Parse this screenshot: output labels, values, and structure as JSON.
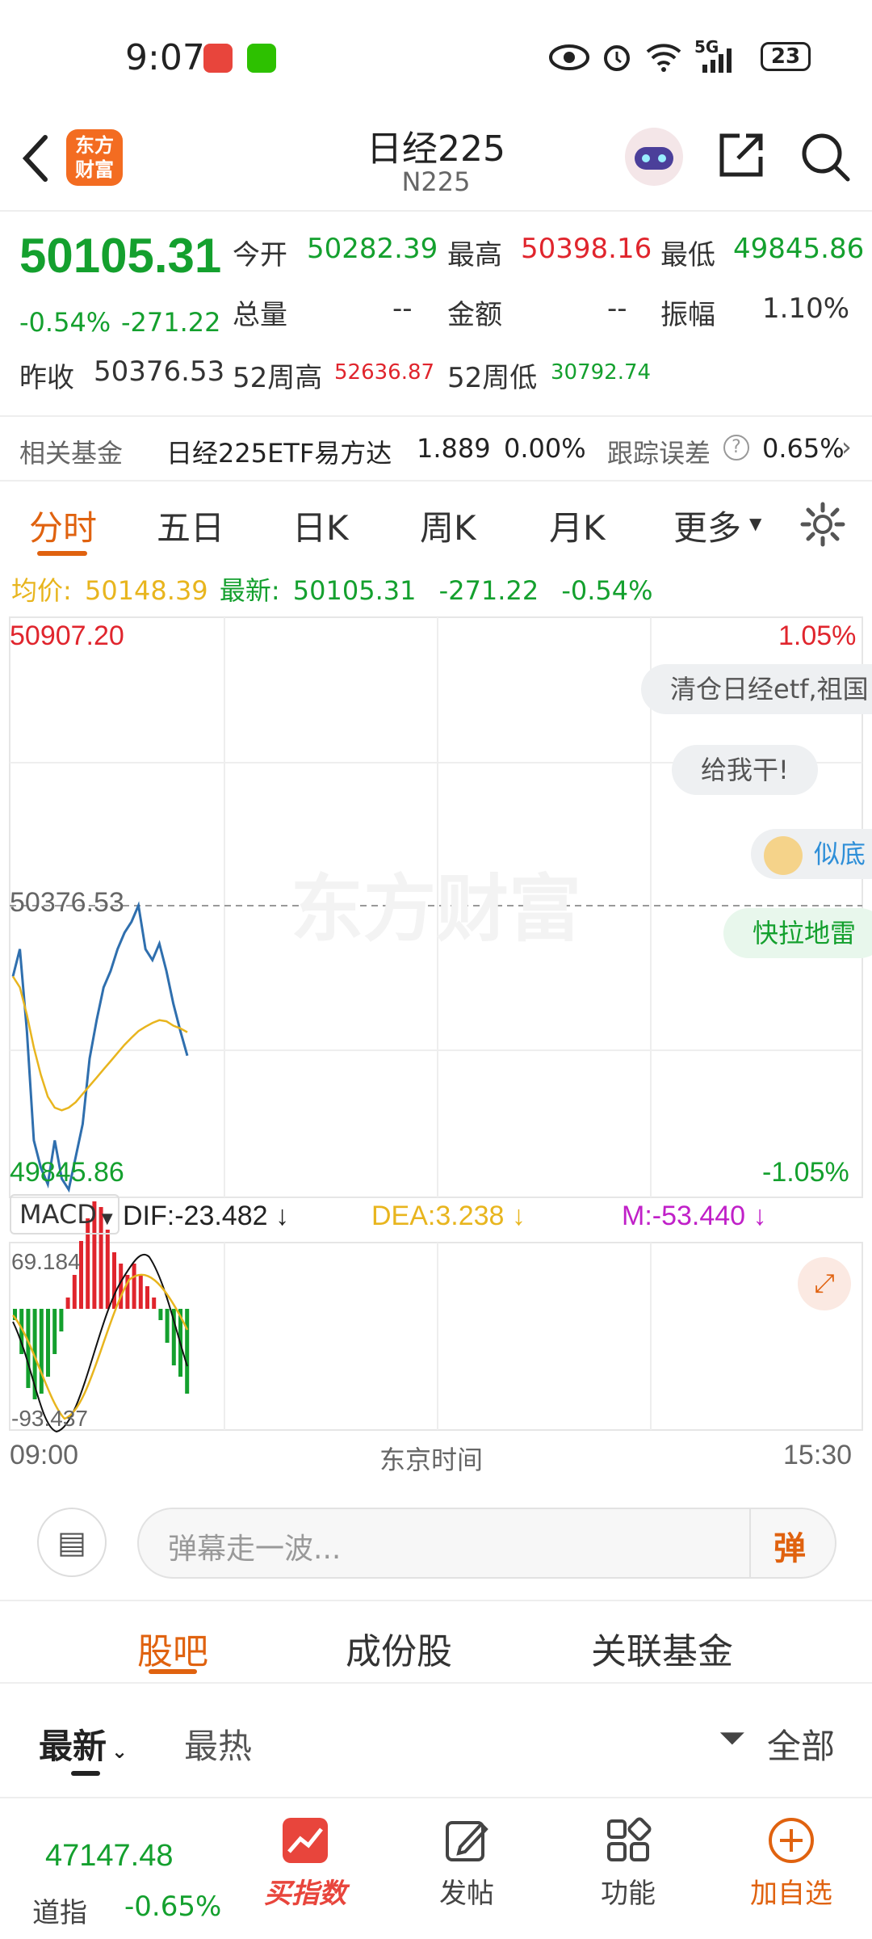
{
  "status_bar": {
    "time": "9:07",
    "network": "5G",
    "battery": "23"
  },
  "header": {
    "logo_text": "东方财富",
    "title": "日经225",
    "subtitle": "N225"
  },
  "quote": {
    "price": "50105.31",
    "change_pct": "-0.54%",
    "change": "-271.22",
    "open_label": "今开",
    "open": "50282.39",
    "high_label": "最高",
    "high": "50398.16",
    "low_label": "最低",
    "low": "49845.86",
    "volume_label": "总量",
    "volume": "--",
    "amount_label": "金额",
    "amount": "--",
    "amplitude_label": "振幅",
    "amplitude": "1.10%",
    "prev_close_label": "昨收",
    "prev_close": "50376.53",
    "w52_high_label": "52周高",
    "w52_high": "52636.87",
    "w52_low_label": "52周低",
    "w52_low": "30792.74"
  },
  "fund_row": {
    "label": "相关基金",
    "name": "日经225ETF易方达",
    "price": "1.889",
    "change": "0.00%",
    "tracking_label": "跟踪误差",
    "tracking_value": "0.65%"
  },
  "tabs": [
    "分时",
    "五日",
    "日K",
    "周K",
    "月K",
    "更多"
  ],
  "avg_line": {
    "avg_label": "均价:",
    "avg_value": "50148.39",
    "latest_label": "最新:",
    "latest_value": "50105.31",
    "change": "-271.22",
    "change_pct": "-0.54%"
  },
  "chart": {
    "top_price": "50907.20",
    "top_pct": "1.05%",
    "mid_price": "50376.53",
    "bottom_price": "49845.86",
    "bottom_pct": "-1.05%",
    "watermark": "东方财富",
    "macd_select": "MACD",
    "dif": "DIF:-23.482",
    "dea": "DEA:3.238",
    "m": "M:-53.440",
    "macd_top": "69.184",
    "macd_bottom": "-93.437",
    "time_start": "09:00",
    "time_label": "东京时间",
    "time_end": "15:30",
    "colors": {
      "price_line": "#2f6fae",
      "avg_line": "#e8b51e",
      "up": "#e0252d",
      "down": "#14a02e"
    }
  },
  "chart_data": {
    "type": "line",
    "series": [
      {
        "name": "",
        "values": [
          50250,
          50300,
          50150,
          49950,
          49900,
          49870,
          49950,
          49880,
          49860,
          49920,
          49980,
          50100,
          50170,
          50230,
          50260,
          50300,
          50330,
          50350,
          50380,
          50300,
          50280,
          50310,
          50260,
          50200,
          50150,
          50105
        ]
      },
      {
        "name": "",
        "values": [
          50250,
          50230,
          50180,
          50120,
          50070,
          50030,
          50010,
          50005,
          50010,
          50020,
          50035,
          50050,
          50065,
          50080,
          50095,
          50110,
          50125,
          50138,
          50150,
          50158,
          50165,
          50170,
          50168,
          50160,
          50155,
          50148
        ]
      }
    ],
    "ylim": [
      49845.86,
      50907.2
    ]
  },
  "danmu": [
    "清仓日经etf,祖国",
    "给我干!",
    "似底",
    "快拉地雷"
  ],
  "danmu_bar": {
    "placeholder": "弹幕走一波...",
    "send_label": "弹"
  },
  "sub_tabs": [
    "股吧",
    "成份股",
    "关联基金"
  ],
  "filters": {
    "latest": "最新",
    "hot": "最热",
    "all": "全部"
  },
  "bottom_nav": {
    "index_value": "47147.48",
    "index_name": "道指",
    "index_change": "-0.65%",
    "buy_index": "买指数",
    "post": "发帖",
    "function": "功能",
    "add_watch": "加自选"
  }
}
